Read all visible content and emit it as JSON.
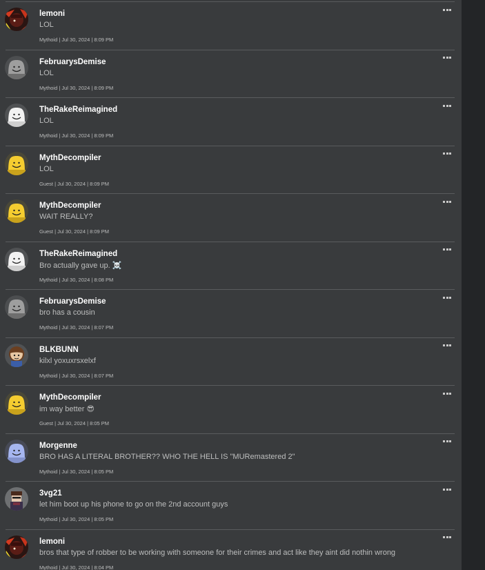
{
  "posts": [
    {
      "username": "lemoni",
      "message": "LOL",
      "meta": "Mythoid | Jul 30, 2024 | 8:09 PM",
      "avatar": "lemoni-avatar"
    },
    {
      "username": "FebruarysDemise",
      "message": "LOL",
      "meta": "Mythoid | Jul 30, 2024 | 8:09 PM",
      "avatar": "gray-smile-avatar"
    },
    {
      "username": "TheRakeReimagined",
      "message": "LOL",
      "meta": "Mythoid | Jul 30, 2024 | 8:09 PM",
      "avatar": "white-smile-avatar"
    },
    {
      "username": "MythDecompiler",
      "message": "LOL",
      "meta": "Guest | Jul 30, 2024 | 8:09 PM",
      "avatar": "yellow-smile-avatar"
    },
    {
      "username": "MythDecompiler",
      "message": "WAIT REALLY?",
      "meta": "Guest | Jul 30, 2024 | 8:09 PM",
      "avatar": "yellow-smile-avatar"
    },
    {
      "username": "TheRakeReimagined",
      "message": "Bro actually gave up. ☠️",
      "meta": "Mythoid | Jul 30, 2024 | 8:08 PM",
      "avatar": "white-smile-avatar"
    },
    {
      "username": "FebruarysDemise",
      "message": "bro has a cousin",
      "meta": "Mythoid | Jul 30, 2024 | 8:07 PM",
      "avatar": "gray-smile-avatar"
    },
    {
      "username": "BLKBUNN",
      "message": "kilxl yoxuxrsxelxf",
      "meta": "Mythoid | Jul 30, 2024 | 8:07 PM",
      "avatar": "blkbunn-avatar"
    },
    {
      "username": "MythDecompiler",
      "message": "im way better 😎",
      "meta": "Guest | Jul 30, 2024 | 8:05 PM",
      "avatar": "yellow-smile-avatar"
    },
    {
      "username": "Morgenne",
      "message": "BRO HAS A LITERAL BROTHER?? WHO THE HELL IS \"MURemastered 2\"",
      "meta": "Mythoid | Jul 30, 2024 | 8:05 PM",
      "avatar": "blue-smile-avatar"
    },
    {
      "username": "3vg21",
      "message": "let him boot up his phone to go on the 2nd account guys",
      "meta": "Mythoid | Jul 30, 2024 | 8:05 PM",
      "avatar": "3vg21-avatar"
    },
    {
      "username": "lemoni",
      "message": "bros that type of robber to be working with someone for their crimes and act like they aint did nothin wrong",
      "meta": "Mythoid | Jul 30, 2024 | 8:04 PM",
      "avatar": "lemoni-avatar"
    }
  ],
  "colors": {
    "feed_bg": "#393b3d",
    "page_bg": "#232527",
    "divider": "#5a5c5e",
    "username": "#ffffff",
    "text": "#bdbebe"
  },
  "icons": {
    "more": "more-options-icon"
  }
}
